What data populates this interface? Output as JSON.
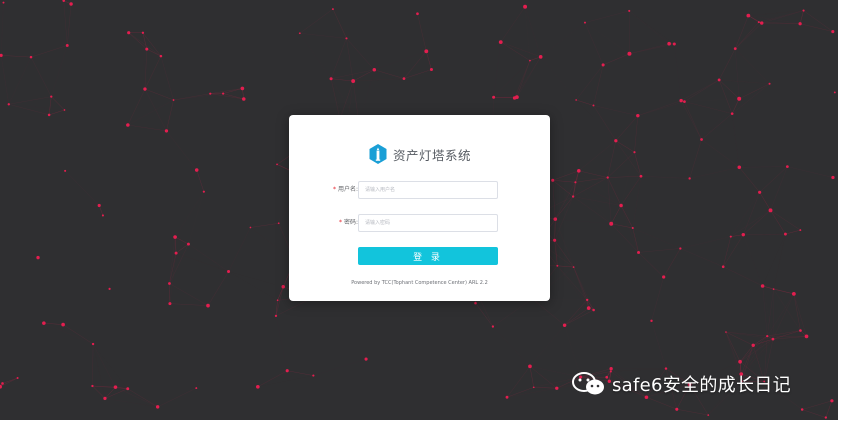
{
  "brand": {
    "title": "资产灯塔系统",
    "logo_icon": "lighthouse-icon"
  },
  "form": {
    "username": {
      "label": "用户名:",
      "placeholder": "请输入用户名",
      "value": ""
    },
    "password": {
      "label": "密码:",
      "placeholder": "请输入密码",
      "value": ""
    },
    "required_mark": "*",
    "login_label": "登 录"
  },
  "footer": {
    "powered_by": "Powered by TCC(Tophant Competence Center) ARL 2.2"
  },
  "watermark": {
    "text": "safe6安全的成长日记",
    "icon": "wechat-icon"
  },
  "colors": {
    "background": "#2f2f31",
    "network_dots": "#e31e4f",
    "accent": "#12c4dc",
    "required": "#e6202a"
  }
}
